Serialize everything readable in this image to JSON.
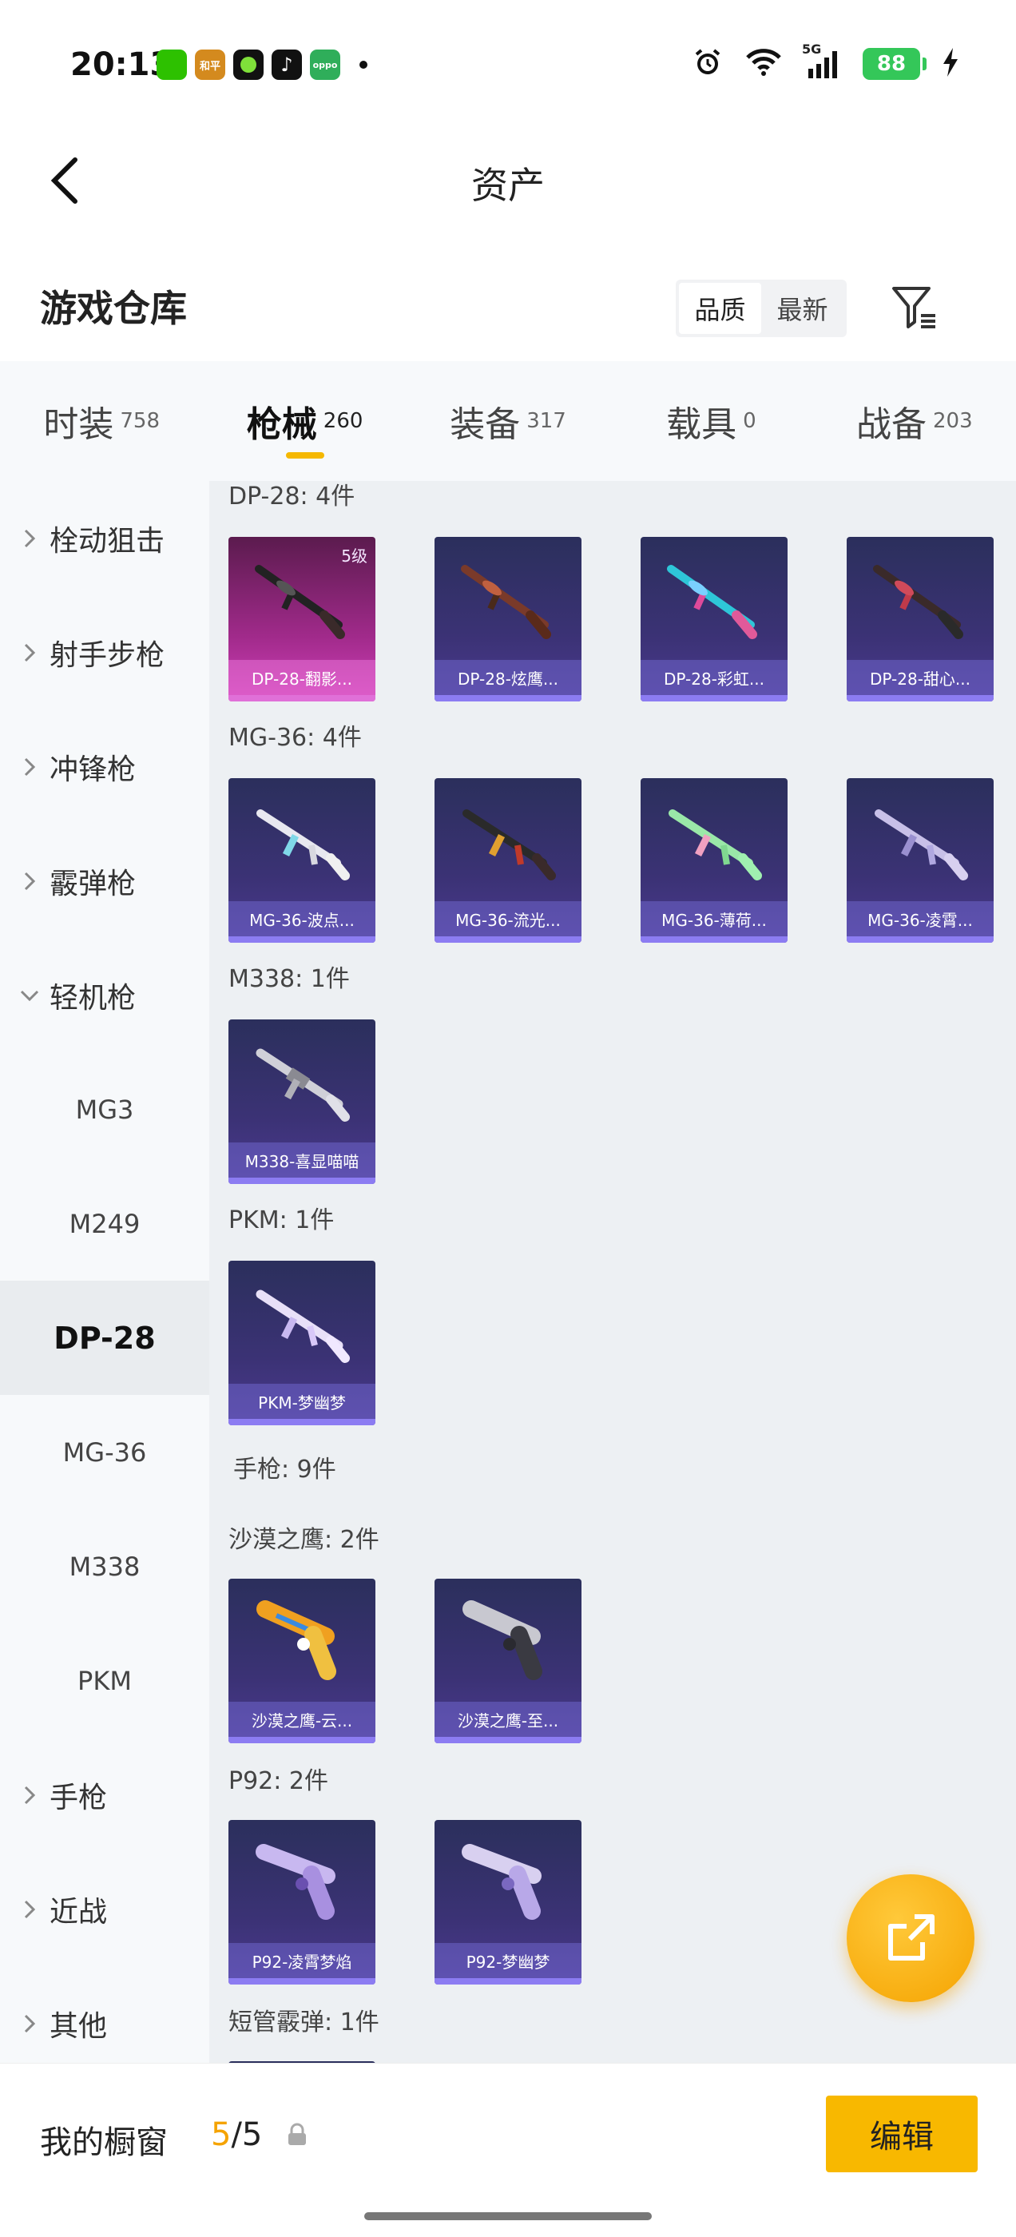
{
  "status_bar": {
    "time": "20:13",
    "apps": [
      {
        "icon": "wechat-icon",
        "color": "#2dc100",
        "text": ""
      },
      {
        "icon": "game-app-icon",
        "color": "#d48a1e",
        "text": "和平"
      },
      {
        "icon": "app-green-icon",
        "color": "#111111",
        "text": ""
      },
      {
        "icon": "tiktok-icon",
        "color": "#111111",
        "text": "♪"
      },
      {
        "icon": "oppo-store-icon",
        "color": "#2fae5a",
        "text": "oppo"
      }
    ],
    "network": "5G",
    "battery": "88"
  },
  "header": {
    "title": "资产"
  },
  "warehouse": {
    "title": "游戏仓库",
    "sort_options": [
      "品质",
      "最新"
    ],
    "active_sort": 0
  },
  "category_tabs": [
    {
      "label": "时装",
      "count": "758"
    },
    {
      "label": "枪械",
      "count": "260"
    },
    {
      "label": "装备",
      "count": "317"
    },
    {
      "label": "载具",
      "count": "0"
    },
    {
      "label": "战备",
      "count": "203"
    }
  ],
  "active_category": 1,
  "sidebar": {
    "items": [
      {
        "label": "栓动狙击",
        "type": "group",
        "expanded": false
      },
      {
        "label": "射手步枪",
        "type": "group",
        "expanded": false
      },
      {
        "label": "冲锋枪",
        "type": "group",
        "expanded": false
      },
      {
        "label": "霰弹枪",
        "type": "group",
        "expanded": false
      },
      {
        "label": "轻机枪",
        "type": "group",
        "expanded": true
      },
      {
        "label": "MG3",
        "type": "sub"
      },
      {
        "label": "M249",
        "type": "sub"
      },
      {
        "label": "DP-28",
        "type": "sub",
        "active": true
      },
      {
        "label": "MG-36",
        "type": "sub"
      },
      {
        "label": "M338",
        "type": "sub"
      },
      {
        "label": "PKM",
        "type": "sub"
      },
      {
        "label": "手枪",
        "type": "group",
        "expanded": false
      },
      {
        "label": "近战",
        "type": "group",
        "expanded": false
      },
      {
        "label": "其他",
        "type": "group",
        "expanded": false
      }
    ]
  },
  "groups": [
    {
      "title": "DP-28: 4件",
      "items": [
        {
          "name": "DP-28-翻影...",
          "level": "5级",
          "rarity": "pink"
        },
        {
          "name": "DP-28-炫鹰...",
          "rarity": "purple"
        },
        {
          "name": "DP-28-彩虹...",
          "rarity": "purple"
        },
        {
          "name": "DP-28-甜心...",
          "rarity": "purple"
        }
      ]
    },
    {
      "title": "MG-36: 4件",
      "items": [
        {
          "name": "MG-36-波点...",
          "rarity": "purple"
        },
        {
          "name": "MG-36-流光...",
          "rarity": "purple"
        },
        {
          "name": "MG-36-薄荷...",
          "rarity": "purple"
        },
        {
          "name": "MG-36-凌霄...",
          "rarity": "purple"
        }
      ]
    },
    {
      "title": "M338: 1件",
      "items": [
        {
          "name": "M338-喜显喵喵",
          "rarity": "purple"
        }
      ]
    },
    {
      "title": "PKM: 1件",
      "items": [
        {
          "name": "PKM-梦幽梦",
          "rarity": "purple"
        }
      ]
    },
    {
      "title": "手枪: 9件",
      "items": []
    },
    {
      "title": "沙漠之鹰: 2件",
      "items": [
        {
          "name": "沙漠之鹰-云...",
          "rarity": "purple"
        },
        {
          "name": "沙漠之鹰-至...",
          "rarity": "purple"
        }
      ]
    },
    {
      "title": "P92: 2件",
      "items": [
        {
          "name": "P92-凌霄梦焰",
          "rarity": "purple"
        },
        {
          "name": "P92-梦幽梦",
          "rarity": "purple"
        }
      ]
    },
    {
      "title": "短管霰弹: 1件",
      "items": [
        {
          "name": "",
          "rarity": "purple"
        }
      ]
    }
  ],
  "bottom_bar": {
    "showcase_label": "我的橱窗",
    "showcase_used": "5",
    "showcase_total": "/5",
    "edit_label": "编辑"
  }
}
